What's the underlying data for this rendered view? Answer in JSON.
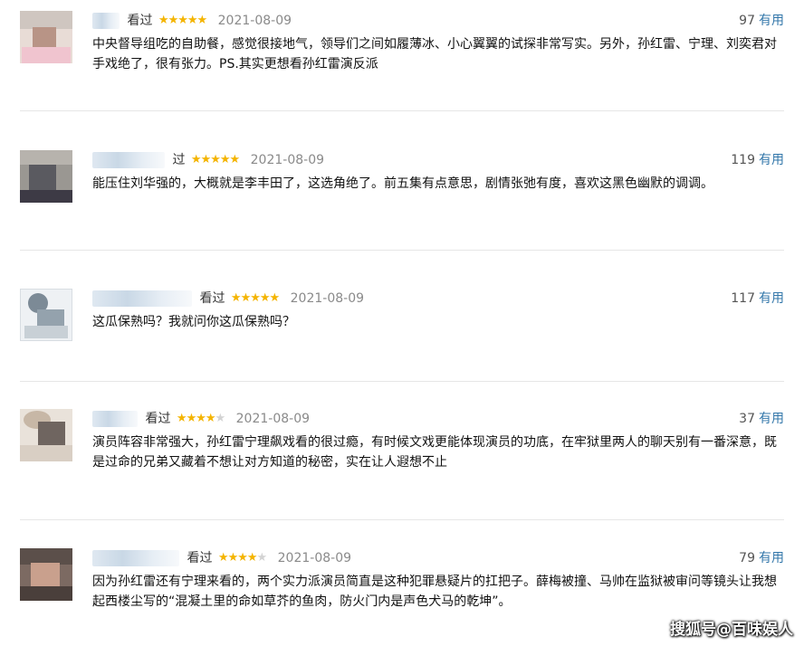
{
  "reviews": [
    {
      "status": "看过",
      "rating": 5,
      "date": "2021-08-09",
      "votes": "97",
      "useful_label": "有用",
      "text": "中央督导组吃的自助餐，感觉很接地气，领导们之间如履薄冰、小心翼翼的试探非常写实。另外，孙红雷、宁理、刘奕君对手戏绝了，很有张力。PS.其实更想看孙红雷演反派"
    },
    {
      "status": "过",
      "rating": 5,
      "date": "2021-08-09",
      "votes": "119",
      "useful_label": "有用",
      "text": "能压住刘华强的，大概就是李丰田了，这选角绝了。前五集有点意思，剧情张弛有度，喜欢这黑色幽默的调调。"
    },
    {
      "status": "看过",
      "rating": 5,
      "date": "2021-08-09",
      "votes": "117",
      "useful_label": "有用",
      "text": "这瓜保熟吗？我就问你这瓜保熟吗？"
    },
    {
      "status": "看过",
      "rating": 4,
      "date": "2021-08-09",
      "votes": "37",
      "useful_label": "有用",
      "text": "演员阵容非常强大，孙红雷宁理飙戏看的很过瘾，有时候文戏更能体现演员的功底，在牢狱里两人的聊天别有一番深意，既是过命的兄弟又藏着不想让对方知道的秘密，实在让人遐想不止"
    },
    {
      "status": "看过",
      "rating": 4,
      "date": "2021-08-09",
      "votes": "79",
      "useful_label": "有用",
      "text": "因为孙红雷还有宁理来看的，两个实力派演员简直是这种犯罪悬疑片的扛把子。薛梅被撞、马帅在监狱被审问等镜头让我想起西楼尘写的“混凝土里的命如草芥的鱼肉，防火门内是声色犬马的乾坤”。"
    }
  ],
  "watermark": "搜狐号@百味娱人",
  "colors": {
    "star": "#f4b400",
    "star_empty": "#d3d3d3",
    "link": "#3377aa",
    "date": "#8a8a8a",
    "divider": "#e6e6e6"
  },
  "icons": {
    "star": "star-icon"
  }
}
